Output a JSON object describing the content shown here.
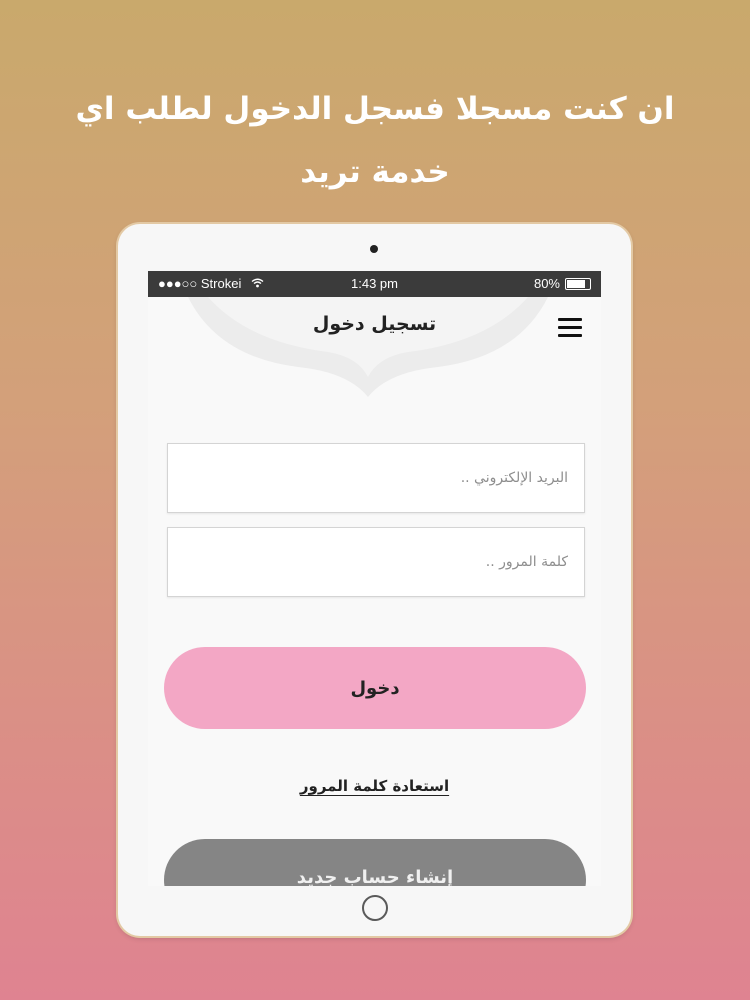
{
  "headline": {
    "line1": "ان كنت مسجلا فسجل الدخول لطلب اي",
    "line2": "خدمة تريد"
  },
  "status_bar": {
    "carrier": "●●●○○ Strokei",
    "time": "1:43 pm",
    "battery_text": "80%",
    "battery_level": 0.8
  },
  "nav": {
    "title": "تسجيل دخول",
    "menu_icon": "hamburger-menu-icon"
  },
  "form": {
    "email_placeholder": "البريد الإلكتروني ..",
    "email_value": "",
    "password_placeholder": "كلمة المرور ..",
    "password_value": "",
    "login_label": "دخول",
    "forgot_label": "استعادة كلمة المرور",
    "register_label": "إنشاء حساب جديد"
  },
  "colors": {
    "login_button": "#f3a7c5",
    "register_button": "#858585",
    "status_bar": "#3b3b3b"
  }
}
